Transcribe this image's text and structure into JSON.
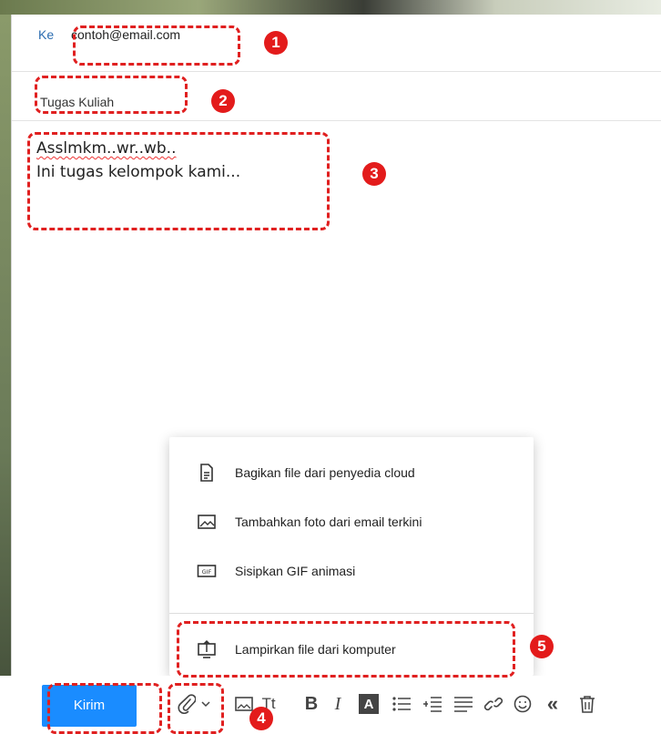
{
  "compose": {
    "to_label": "Ke",
    "to_value": "contoh@email.com",
    "subject": "Tugas Kuliah",
    "body_lines": [
      "Asslmkm..wr..wb..",
      "Ini tugas kelompok kami..."
    ]
  },
  "attach_menu": {
    "items": [
      {
        "label": "Bagikan file dari penyedia cloud",
        "icon": "document-icon"
      },
      {
        "label": "Tambahkan foto dari email terkini",
        "icon": "image-icon"
      },
      {
        "label": "Sisipkan GIF animasi",
        "icon": "gif-icon"
      },
      {
        "label": "Lampirkan file dari komputer",
        "icon": "computer-upload-icon"
      }
    ]
  },
  "toolbar": {
    "send_label": "Kirim",
    "icons": [
      "paperclip-icon",
      "chevron-down-icon",
      "insert-image-icon",
      "font-size-icon",
      "bold-icon",
      "italic-icon",
      "highlight-icon",
      "bullet-list-icon",
      "indent-icon",
      "align-icon",
      "link-icon",
      "emoji-icon",
      "quote-icon",
      "delete-icon"
    ],
    "font_size_glyph": "Tt",
    "bold_glyph": "B",
    "italic_glyph": "I",
    "highlight_glyph": "A"
  },
  "annotations": {
    "badges": [
      "1",
      "2",
      "3",
      "4",
      "5"
    ],
    "color": "#e31b1b"
  },
  "colors": {
    "accent": "#1a8cff",
    "annotation_dash": "#e02020"
  }
}
